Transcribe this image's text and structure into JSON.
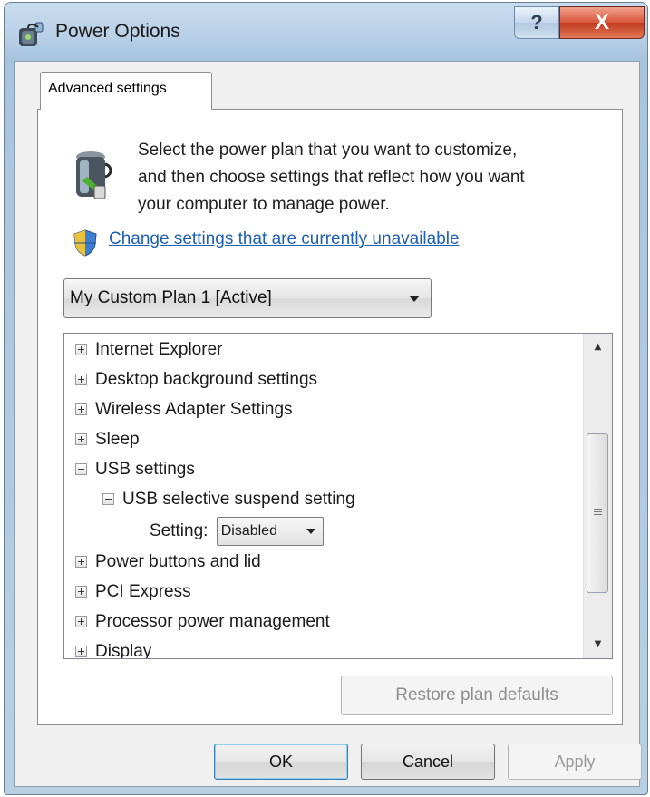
{
  "window": {
    "title": "Power Options",
    "help_glyph": "?",
    "close_glyph": "X"
  },
  "tab": {
    "label": "Advanced settings"
  },
  "intro": {
    "line1": "Select the power plan that you want to customize,",
    "line2": "and then choose settings that reflect how you want",
    "line3": "your computer to manage power."
  },
  "change_link": "Change settings that are currently unavailable",
  "plan_select": {
    "value": "My Custom Plan 1 [Active]"
  },
  "tree": {
    "items": [
      {
        "label": "Internet Explorer",
        "state": "collapsed"
      },
      {
        "label": "Desktop background settings",
        "state": "collapsed"
      },
      {
        "label": "Wireless Adapter Settings",
        "state": "collapsed"
      },
      {
        "label": "Sleep",
        "state": "collapsed"
      },
      {
        "label": "USB settings",
        "state": "expanded"
      },
      {
        "label": "USB selective suspend setting",
        "state": "expanded"
      },
      {
        "label": "Setting:",
        "value": "Disabled"
      },
      {
        "label": "Power buttons and lid",
        "state": "collapsed"
      },
      {
        "label": "PCI Express",
        "state": "collapsed"
      },
      {
        "label": "Processor power management",
        "state": "collapsed"
      },
      {
        "label": "Display",
        "state": "collapsed"
      }
    ]
  },
  "buttons": {
    "restore": "Restore plan defaults",
    "ok": "OK",
    "cancel": "Cancel",
    "apply": "Apply"
  },
  "colors": {
    "link": "#1d5fb3",
    "close_button": "#c23a1f",
    "client_bg": "#f0f0f0"
  }
}
